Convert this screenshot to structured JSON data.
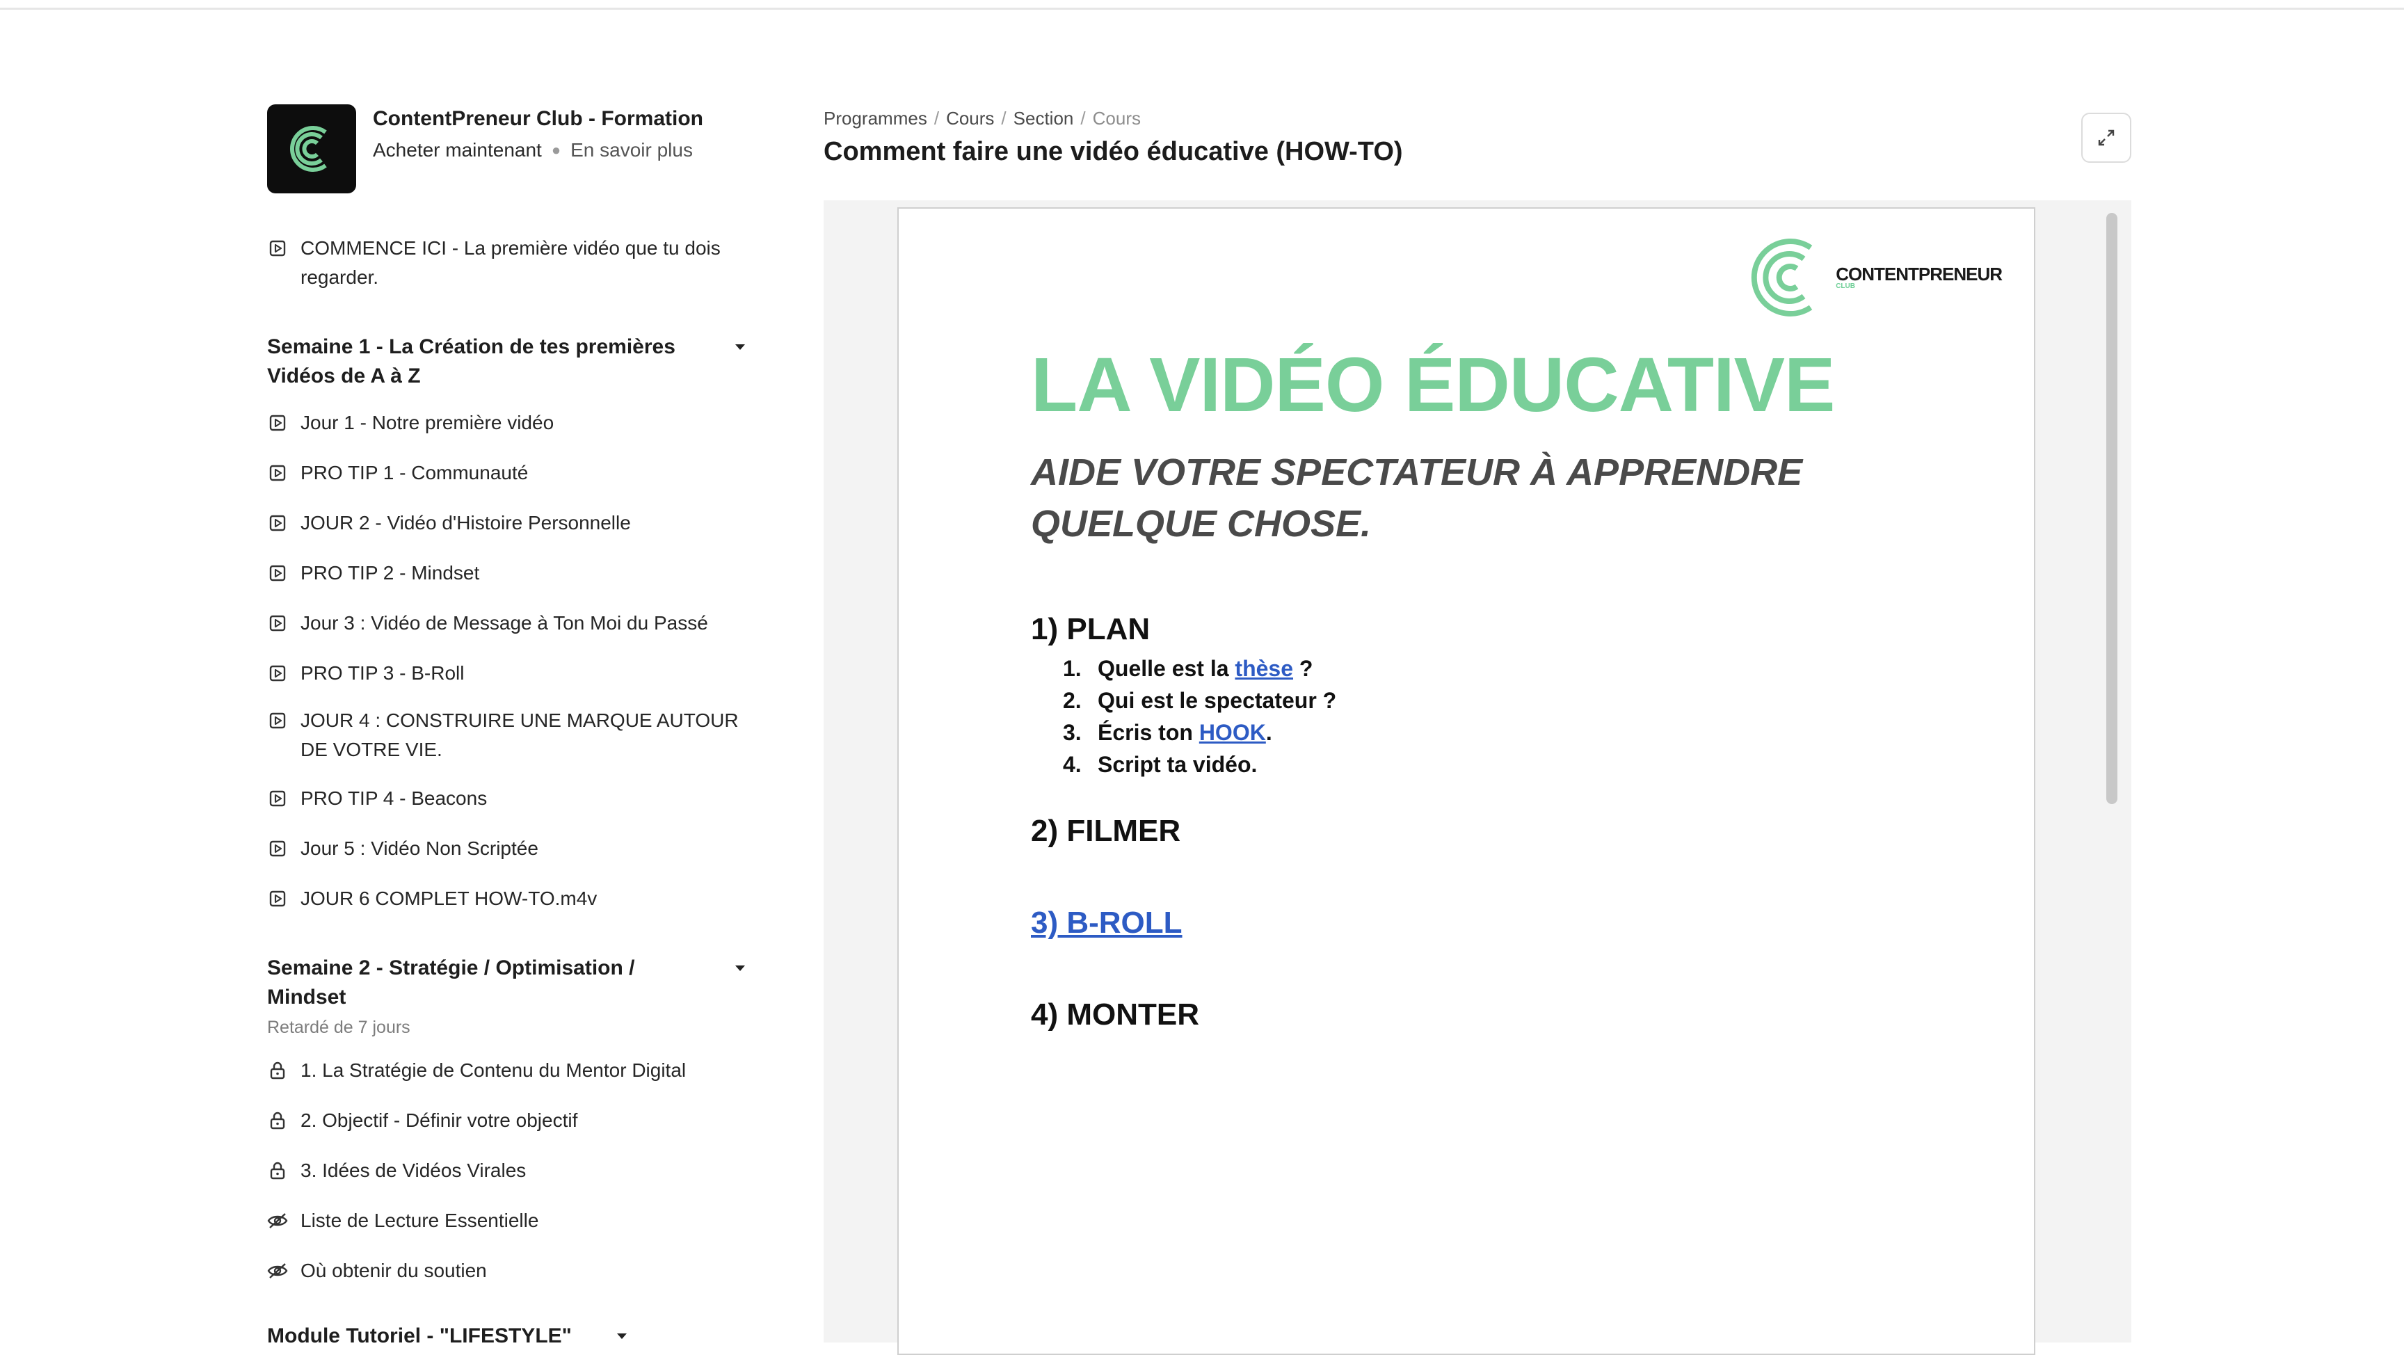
{
  "course": {
    "title": "ContentPreneur Club - Formation",
    "buy_label": "Acheter maintenant",
    "learn_more_label": "En savoir plus"
  },
  "sidebar": {
    "intro_item": "COMMENCE ICI - La première vidéo que tu dois regarder.",
    "week1": {
      "title": "Semaine 1 - La Création de tes premières Vidéos de A à Z",
      "items": [
        "Jour 1 - Notre première vidéo",
        "PRO TIP 1 - Communauté",
        "JOUR 2 - Vidéo d'Histoire Personnelle",
        "PRO TIP 2 - Mindset",
        "Jour 3 : Vidéo de Message à Ton Moi du Passé",
        "PRO TIP 3 - B-Roll",
        "JOUR 4 : CONSTRUIRE UNE MARQUE AUTOUR DE VOTRE VIE.",
        "PRO TIP 4 - Beacons",
        "Jour 5 : Vidéo Non Scriptée",
        "JOUR 6 COMPLET HOW-TO.m4v"
      ]
    },
    "week2": {
      "title": "Semaine 2 - Stratégie / Optimisation / Mindset",
      "delay": "Retardé de 7 jours",
      "locked_items": [
        "1. La Stratégie de Contenu du Mentor Digital",
        "2. Objectif - Définir votre objectif",
        "3. Idées de Vidéos Virales"
      ],
      "hidden_items": [
        "Liste de Lecture Essentielle",
        "Où obtenir du soutien"
      ]
    },
    "module_title": "Module Tutoriel - \"LIFESTYLE\""
  },
  "breadcrumb": {
    "programs": "Programmes",
    "courses": "Cours",
    "section": "Section",
    "current": "Cours",
    "separator": "/"
  },
  "lesson": {
    "title": "Comment faire une vidéo éducative (HOW-TO)"
  },
  "document": {
    "logo_text": "CONTENTPRENEUR",
    "logo_sub": "CLUB",
    "heading": "LA VIDÉO ÉDUCATIVE",
    "subheading": "AIDE VOTRE SPECTATEUR À APPRENDRE QUELQUE CHOSE.",
    "section1": "1) PLAN",
    "list": {
      "n1": "1.",
      "i1_pre": "Quelle est la",
      "i1_link": "thèse",
      "i1_post": "?",
      "n2": "2.",
      "i2": "Qui est le spectateur ?",
      "n3": "3.",
      "i3_pre": "Écris ton",
      "i3_link": "HOOK",
      "i3_post": ".",
      "n4": "4.",
      "i4": "Script ta vidéo."
    },
    "section2": "2) FILMER",
    "section3": "3) B-ROLL",
    "section4": "4) MONTER"
  },
  "colors": {
    "accent_green": "#79cf99",
    "link_blue": "#2d5bc4"
  }
}
